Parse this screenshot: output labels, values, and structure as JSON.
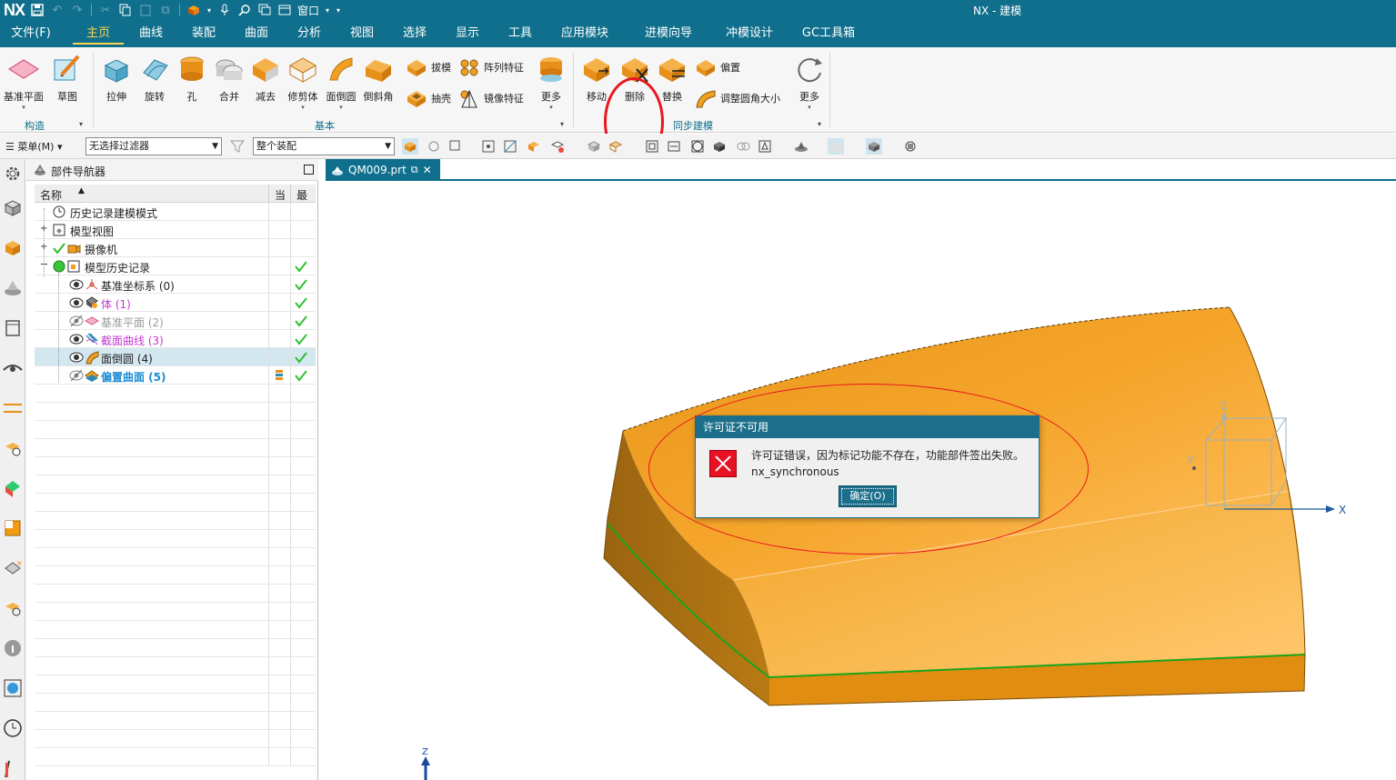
{
  "app": {
    "logo": "NX",
    "title": "NX - 建模",
    "window_menu": "窗口"
  },
  "menu_tabs": [
    "文件(F)",
    "主页",
    "曲线",
    "装配",
    "曲面",
    "分析",
    "视图",
    "选择",
    "显示",
    "工具",
    "应用模块",
    "进模向导",
    "冲模设计",
    "GC工具箱"
  ],
  "active_tab": "主页",
  "ribbon": {
    "construct": {
      "datum_plane": "基准平面",
      "sketch": "草图",
      "group": "构造"
    },
    "basic": {
      "extrude": "拉伸",
      "revolve": "旋转",
      "hole": "孔",
      "unite": "合并",
      "subtract": "减去",
      "trim_body": "修剪体",
      "face_blend": "面倒圆",
      "chamfer": "倒斜角",
      "draft": "拔模",
      "pattern_feature": "阵列特征",
      "shell": "抽壳",
      "mirror_feature": "镜像特征",
      "more": "更多",
      "group": "基本"
    },
    "sync": {
      "move": "移动",
      "delete": "删除",
      "replace": "替换",
      "offset": "偏置",
      "resize_blend": "调整圆角大小",
      "more": "更多",
      "group": "同步建模"
    }
  },
  "selbar": {
    "menu": "菜单(M)",
    "filter": "无选择过滤器",
    "scope": "整个装配"
  },
  "navigator": {
    "title": "部件导航器",
    "col_name": "名称",
    "col_current": "当",
    "col_latest": "最",
    "items": [
      {
        "label": "历史记录建模模式"
      },
      {
        "label": "模型视图"
      },
      {
        "label": "摄像机"
      },
      {
        "label": "模型历史记录"
      },
      {
        "label": "基准坐标系 (0)"
      },
      {
        "label": "体 (1)"
      },
      {
        "label": "基准平面 (2)"
      },
      {
        "label": "截面曲线 (3)"
      },
      {
        "label": "面倒圆 (4)"
      },
      {
        "label": "偏置曲面 (5)"
      }
    ]
  },
  "doc_tab": "QM009.prt",
  "dialog": {
    "title": "许可证不可用",
    "message_line1": "许可证错误，因为标记功能不存在，功能部件签出失败。",
    "message_line2": "nx_synchronous",
    "ok": "确定(O)"
  },
  "axes": {
    "z": "Z",
    "y": "Y",
    "x": "X",
    "triad_z": "Z"
  },
  "colors": {
    "titlebar": "#0f6f8c",
    "active_tab": "#ffd34d",
    "body_orange": "#f0a020",
    "annotation_red": "#e8171e",
    "check_green": "#2fbf2f"
  }
}
